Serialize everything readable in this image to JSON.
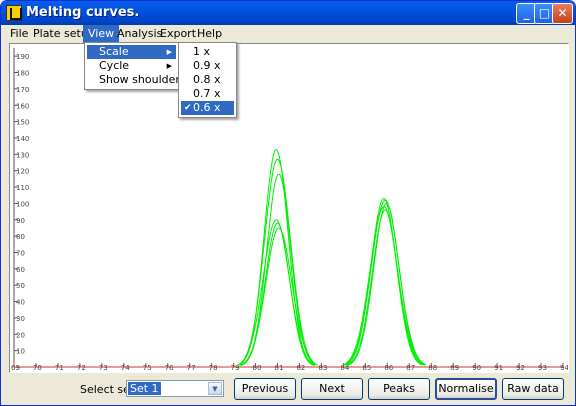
{
  "window": {
    "title": "Melting curves."
  },
  "titlebar_buttons": {
    "minimize": "_",
    "maximize": "□",
    "close": "✕"
  },
  "menubar": [
    "File",
    "Plate setup",
    "View",
    "Analysis",
    "Export",
    "Help"
  ],
  "view_menu": {
    "items": [
      {
        "label": "Scale",
        "submenu": true
      },
      {
        "label": "Cycle",
        "submenu": true
      },
      {
        "label": "Show shoulders",
        "submenu": false
      }
    ]
  },
  "scale_submenu": {
    "items": [
      "1 x",
      "0.9 x",
      "0.8 x",
      "0.7 x",
      "0.6 x"
    ],
    "checked": "0.6 x",
    "check_glyph": "✔"
  },
  "chart_data": {
    "type": "line",
    "y_ticks": [
      "190",
      "180",
      "170",
      "160",
      "150",
      "140",
      "130",
      "120",
      "110",
      "100",
      "90",
      "80",
      "70",
      "60",
      "50",
      "40",
      "30",
      "20",
      "10"
    ],
    "x_ticks": [
      "69",
      "70",
      "71",
      "72",
      "73",
      "74",
      "75",
      "76",
      "77",
      "78",
      "79",
      "80",
      "81",
      "82",
      "83",
      "84",
      "85",
      "86",
      "87",
      "88",
      "89",
      "90",
      "91",
      "92",
      "93",
      "94"
    ],
    "xlim": [
      69,
      94
    ],
    "ylim": [
      0,
      195
    ],
    "series_color": "#00ee00",
    "peaks": [
      {
        "center": 81.0,
        "heights": [
          133,
          127,
          118,
          90,
          88,
          85
        ],
        "width": 0.55
      },
      {
        "center": 85.9,
        "heights": [
          103,
          102,
          100,
          98,
          96
        ],
        "width": 0.58
      }
    ]
  },
  "footer": {
    "select_label": "Select set",
    "select_value": "Set 1",
    "buttons": [
      "Previous",
      "Next",
      "Peaks",
      "Normalise",
      "Raw data"
    ]
  }
}
